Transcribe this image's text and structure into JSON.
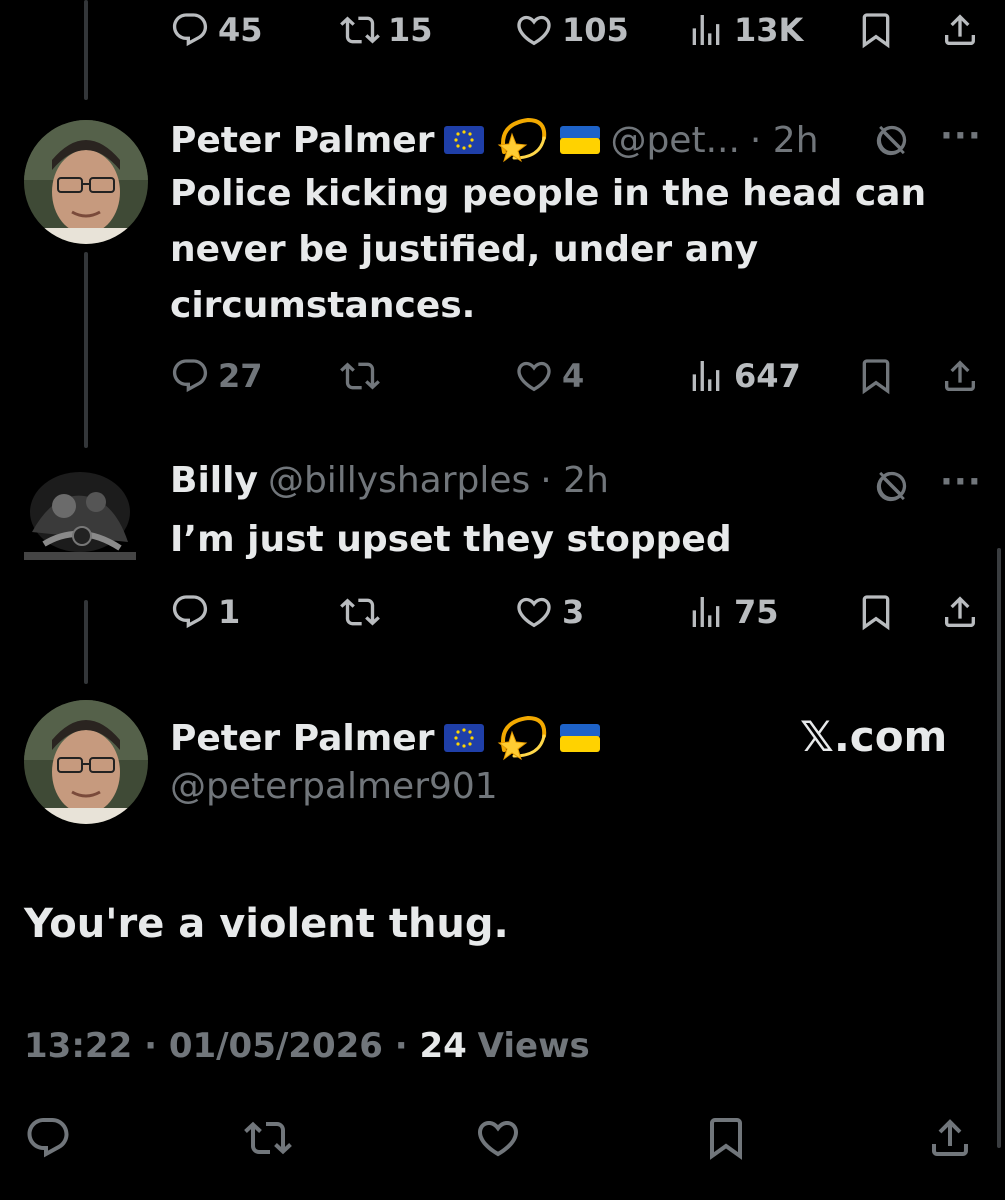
{
  "top_tweet": {
    "actions": {
      "replies": "45",
      "reposts": "15",
      "likes": "105",
      "views": "13K"
    }
  },
  "reply1": {
    "name": "Peter Palmer",
    "handle": "@pet...",
    "time": "· 2h",
    "text": "Police kicking people in the head can never be justified, under any circumstances.",
    "actions": {
      "replies": "27",
      "reposts": "",
      "likes": "4",
      "views": "647"
    }
  },
  "reply2": {
    "name": "Billy",
    "handle": "@billysharples",
    "time": "· 2h",
    "text": "I’m just upset they stopped",
    "actions": {
      "replies": "1",
      "reposts": "",
      "likes": "3",
      "views": "75"
    }
  },
  "focused": {
    "name": "Peter Palmer",
    "handle": "@peterpalmer901",
    "brand": "𝕏.com",
    "text": "You're a violent thug.",
    "time": "13:22",
    "date": "01/05/2026",
    "views_count": "24",
    "views_label": "Views"
  },
  "colors": {
    "background": "#000000",
    "text": "#e7e9ea",
    "muted": "#71767b",
    "thread_line": "#333639"
  },
  "icons": [
    "reply-icon",
    "repost-icon",
    "like-icon",
    "views-icon",
    "bookmark-icon",
    "share-icon",
    "grok-icon",
    "more-icon",
    "eu-flag-icon",
    "dizzy-star-icon",
    "ukraine-flag-icon"
  ]
}
